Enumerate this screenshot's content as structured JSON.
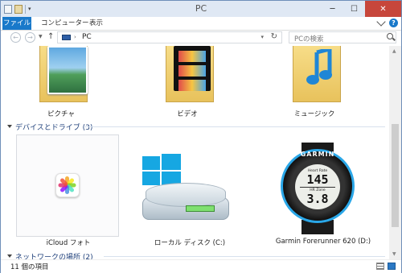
{
  "window": {
    "title": "PC"
  },
  "ribbon": {
    "tabs": [
      "ファイル",
      "コンピューター",
      "表示"
    ],
    "help_icon": "?"
  },
  "address": {
    "breadcrumb_arrow": "›",
    "crumb": "PC",
    "search_placeholder": "PCの検索"
  },
  "folders": [
    {
      "label": "ピクチャ",
      "icon": "pictures-folder-icon"
    },
    {
      "label": "ビデオ",
      "icon": "videos-folder-icon"
    },
    {
      "label": "ミュージック",
      "icon": "music-folder-icon"
    }
  ],
  "groups": {
    "devices": "デバイスとドライブ (3)",
    "network": "ネットワークの場所 (2)"
  },
  "drives": [
    {
      "label": "iCloud フォト",
      "icon": "icloud-photos-icon",
      "selected": true
    },
    {
      "label": "ローカル ディスク (C:)",
      "icon": "local-disk-icon",
      "selected": false
    },
    {
      "label": "Garmin Forerunner 620 (D:)",
      "icon": "garmin-watch-icon",
      "selected": false
    }
  ],
  "watch_face": {
    "brand": "GARMIN",
    "label1": "Heart Rate",
    "value1": "145",
    "label2": "HR Zone",
    "value2": "3.8"
  },
  "status": {
    "item_count": "11 個の項目"
  },
  "colors": {
    "accent": "#1979ca",
    "close": "#c7463b",
    "group_header": "#1e3f7a",
    "windows_logo": "#16a7e2",
    "watch_ring": "#2aa7e8"
  }
}
